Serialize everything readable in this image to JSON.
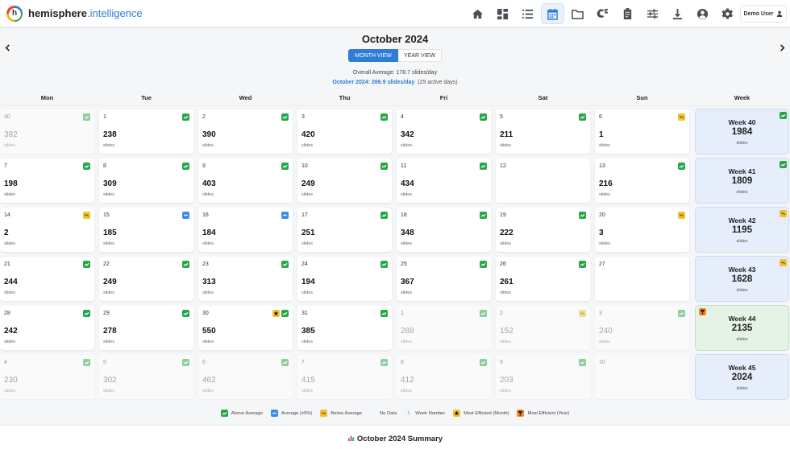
{
  "app": {
    "logo_letter": "h",
    "brand_main": "hemisphere",
    "brand_accent": ".intelligence",
    "user_label": "Demo User"
  },
  "nav_icons": [
    "home-icon",
    "dashboard-icon",
    "list-icon",
    "calendar-icon",
    "folder-icon",
    "copyright-icon",
    "clipboard-icon",
    "sliders-icon",
    "download-icon",
    "account-icon",
    "settings-icon"
  ],
  "active_nav": "calendar-icon",
  "header": {
    "title": "October 2024",
    "month_view": "MONTH VIEW",
    "year_view": "YEAR VIEW",
    "overall": "Overall Average: 178.7 slides/day",
    "month_avg": "October 2024: 266.9 slides/day",
    "active_days": "(29 active days)"
  },
  "days_header": [
    "Mon",
    "Tue",
    "Wed",
    "Thu",
    "Fri",
    "Sat",
    "Sun",
    "Week"
  ],
  "unit": "slides",
  "weeks": [
    {
      "label": "Week 40",
      "total": "1984",
      "badge": "above",
      "days": [
        {
          "d": "30",
          "v": "382",
          "b": "above",
          "o": true
        },
        {
          "d": "1",
          "v": "238",
          "b": "above"
        },
        {
          "d": "2",
          "v": "390",
          "b": "above"
        },
        {
          "d": "3",
          "v": "420",
          "b": "above"
        },
        {
          "d": "4",
          "v": "342",
          "b": "above"
        },
        {
          "d": "5",
          "v": "211",
          "b": "above"
        },
        {
          "d": "6",
          "v": "1",
          "b": "below"
        }
      ]
    },
    {
      "label": "Week 41",
      "total": "1809",
      "badge": "above",
      "days": [
        {
          "d": "7",
          "v": "198",
          "b": "above"
        },
        {
          "d": "8",
          "v": "309",
          "b": "above"
        },
        {
          "d": "9",
          "v": "403",
          "b": "above"
        },
        {
          "d": "10",
          "v": "249",
          "b": "above"
        },
        {
          "d": "11",
          "v": "434",
          "b": "above"
        },
        {
          "d": "12",
          "v": "",
          "b": ""
        },
        {
          "d": "13",
          "v": "216",
          "b": "above"
        }
      ]
    },
    {
      "label": "Week 42",
      "total": "1195",
      "badge": "below",
      "days": [
        {
          "d": "14",
          "v": "2",
          "b": "below"
        },
        {
          "d": "15",
          "v": "185",
          "b": "avg"
        },
        {
          "d": "16",
          "v": "184",
          "b": "avg"
        },
        {
          "d": "17",
          "v": "251",
          "b": "above"
        },
        {
          "d": "18",
          "v": "348",
          "b": "above"
        },
        {
          "d": "19",
          "v": "222",
          "b": "above"
        },
        {
          "d": "20",
          "v": "3",
          "b": "below"
        }
      ]
    },
    {
      "label": "Week 43",
      "total": "1628",
      "badge": "below",
      "days": [
        {
          "d": "21",
          "v": "244",
          "b": "above"
        },
        {
          "d": "22",
          "v": "249",
          "b": "above"
        },
        {
          "d": "23",
          "v": "313",
          "b": "above"
        },
        {
          "d": "24",
          "v": "194",
          "b": "above"
        },
        {
          "d": "25",
          "v": "367",
          "b": "above"
        },
        {
          "d": "26",
          "v": "261",
          "b": "above"
        },
        {
          "d": "27",
          "v": "",
          "b": ""
        }
      ]
    },
    {
      "label": "Week 44",
      "total": "2135",
      "badge": "trophy",
      "best": true,
      "days": [
        {
          "d": "28",
          "v": "242",
          "b": "above"
        },
        {
          "d": "29",
          "v": "278",
          "b": "above"
        },
        {
          "d": "30",
          "v": "550",
          "b": "above",
          "star": true
        },
        {
          "d": "31",
          "v": "385",
          "b": "above"
        },
        {
          "d": "1",
          "v": "288",
          "b": "above",
          "o": true
        },
        {
          "d": "2",
          "v": "152",
          "b": "below",
          "o": true
        },
        {
          "d": "3",
          "v": "240",
          "b": "above",
          "o": true
        }
      ]
    },
    {
      "label": "Week 45",
      "total": "2024",
      "badge": "",
      "days": [
        {
          "d": "4",
          "v": "230",
          "b": "above",
          "o": true
        },
        {
          "d": "5",
          "v": "302",
          "b": "above",
          "o": true
        },
        {
          "d": "6",
          "v": "462",
          "b": "above",
          "o": true
        },
        {
          "d": "7",
          "v": "415",
          "b": "above",
          "o": true
        },
        {
          "d": "8",
          "v": "412",
          "b": "above",
          "o": true
        },
        {
          "d": "9",
          "v": "203",
          "b": "above",
          "o": true
        },
        {
          "d": "10",
          "v": "",
          "b": "",
          "o": true
        }
      ]
    }
  ],
  "legend": [
    {
      "icon": "above",
      "label": "Above Average"
    },
    {
      "icon": "avg",
      "label": "Average (±5%)"
    },
    {
      "icon": "below",
      "label": "Below Average"
    },
    {
      "icon": "none",
      "label": "No Data"
    },
    {
      "icon": "info",
      "label": "Week Number"
    },
    {
      "icon": "star",
      "label": "Most Efficient (Month)"
    },
    {
      "icon": "trophy",
      "label": "Most Efficient (Year)"
    }
  ],
  "summary_title": "October 2024 Summary",
  "colors": {
    "accent": "#2e7dd7",
    "above": "#27a745",
    "below": "#f1c232",
    "avg": "#3d8be8",
    "week_bg": "#e6eefb",
    "best_week_bg": "#e5f3e6"
  }
}
